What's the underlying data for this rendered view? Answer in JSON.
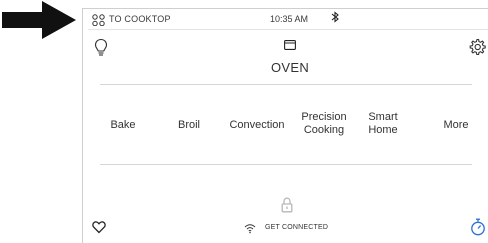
{
  "status_bar": {
    "cooktop_label": "TO COOKTOP",
    "time": "10:35 AM"
  },
  "header": {
    "title": "OVEN"
  },
  "menu": [
    {
      "label": "Bake"
    },
    {
      "label": "Broil"
    },
    {
      "label": "Convection"
    },
    {
      "label": "Precision\nCooking"
    },
    {
      "label": "Smart\nHome"
    },
    {
      "label": "More"
    }
  ],
  "footer": {
    "connect_label": "GET CONNECTED"
  },
  "colors": {
    "timer_accent": "#2a6fd6",
    "arrow": "#111111"
  },
  "icons": [
    "arrow-pointer-icon",
    "burners-icon",
    "bluetooth-icon",
    "lightbulb-icon",
    "oven-icon",
    "gear-icon",
    "lock-icon",
    "wifi-icon",
    "heart-icon",
    "timer-icon"
  ]
}
